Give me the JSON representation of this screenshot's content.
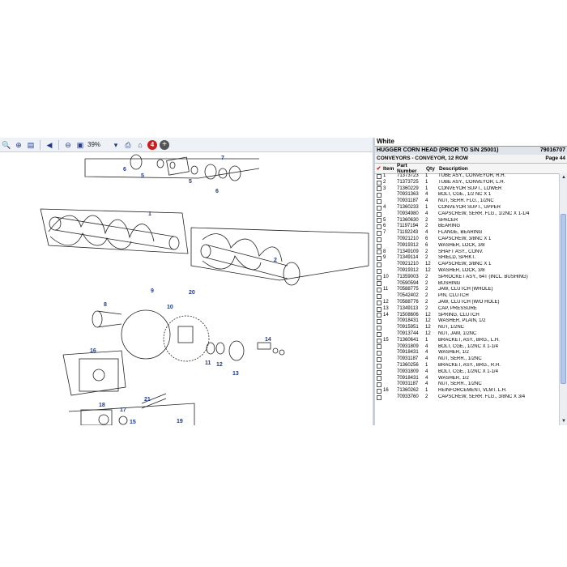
{
  "viewer": {
    "zoom": "39%",
    "badge_count": "4",
    "toolbar_icons": [
      "search-icon",
      "zoom-in-icon",
      "page-icon",
      "first-page-icon",
      "zoom-out-icon",
      "print-icon",
      "home-icon",
      "sync-icon",
      "help-icon",
      "add-icon"
    ]
  },
  "diagram": {
    "labels": [
      "7",
      "6",
      "5",
      "5",
      "6",
      "1",
      "2",
      "9",
      "20",
      "10",
      "8",
      "11",
      "12",
      "16",
      "14",
      "13",
      "21",
      "18",
      "17",
      "19",
      "15"
    ]
  },
  "parts": {
    "make": "White",
    "model": "HUGGER CORN HEAD (PRIOR TO S/N 25001)",
    "model_number": "79016707",
    "section": "CONVEYORS - CONVEYOR, 12 ROW",
    "page": "Page 44",
    "columns": {
      "item": "Item",
      "part": "Part Number",
      "qty": "Qty",
      "desc": "Description"
    },
    "rows": [
      {
        "item": "1",
        "part": "71373723",
        "qty": "1",
        "desc": "TUBE ASY., CONVEYOR, R.H."
      },
      {
        "item": "2",
        "part": "71373725",
        "qty": "1",
        "desc": "TUBE ASY., CONVEYOR, L.H."
      },
      {
        "item": "3",
        "part": "71360229",
        "qty": "1",
        "desc": "CONVEYOR SUPT., LOWER"
      },
      {
        "item": "",
        "part": "70931363",
        "qty": "4",
        "desc": "BOLT, CGE., 1/2 NC X 1"
      },
      {
        "item": "",
        "part": "70931187",
        "qty": "4",
        "desc": "NUT, SERR. FLG., 1/2NC"
      },
      {
        "item": "4",
        "part": "71360233",
        "qty": "1",
        "desc": "CONVEYOR SUPT., UPPER"
      },
      {
        "item": "",
        "part": "70934980",
        "qty": "4",
        "desc": "CAPSCREW, SERR. FLG., 1/2NC X 1-1/4"
      },
      {
        "item": "5",
        "part": "71360630",
        "qty": "2",
        "desc": "SPACER"
      },
      {
        "item": "6",
        "part": "71197194",
        "qty": "2",
        "desc": "BEARING"
      },
      {
        "item": "7",
        "part": "71192243",
        "qty": "4",
        "desc": "FLANGE, BEARING"
      },
      {
        "item": "",
        "part": "70921210",
        "qty": "6",
        "desc": "CAPSCREW, 3/8NC X 1"
      },
      {
        "item": "",
        "part": "70919312",
        "qty": "6",
        "desc": "WASHER, LOCK, 3/8"
      },
      {
        "item": "8",
        "part": "71349109",
        "qty": "2",
        "desc": "SHAFT ASY., CONV."
      },
      {
        "item": "9",
        "part": "71349114",
        "qty": "2",
        "desc": "SHIELD, SPRKT."
      },
      {
        "item": "",
        "part": "70921210",
        "qty": "12",
        "desc": "CAPSCREW, 3/8NC X 1"
      },
      {
        "item": "",
        "part": "70919312",
        "qty": "12",
        "desc": "WASHER, LOCK, 3/8"
      },
      {
        "item": "10",
        "part": "71359003",
        "qty": "2",
        "desc": "SPROCKET ASY., 64T (INCL. BUSHING)"
      },
      {
        "item": "",
        "part": "70590594",
        "qty": "2",
        "desc": "BUSHING"
      },
      {
        "item": "11",
        "part": "70588775",
        "qty": "2",
        "desc": "JAW, CLUTCH (WHOLE)"
      },
      {
        "item": "",
        "part": "70542402",
        "qty": "2",
        "desc": "PIN, CLUTCH"
      },
      {
        "item": "12",
        "part": "70588776",
        "qty": "2",
        "desc": "JAW, CLUTCH (W/O HOLE)"
      },
      {
        "item": "13",
        "part": "71349113",
        "qty": "2",
        "desc": "CAP, PRESSURE"
      },
      {
        "item": "14",
        "part": "71508606",
        "qty": "12",
        "desc": "SPRING, CLUTCH"
      },
      {
        "item": "",
        "part": "70918431",
        "qty": "12",
        "desc": "WASHER, PLAIN, 1/2"
      },
      {
        "item": "",
        "part": "70915951",
        "qty": "12",
        "desc": "NUT, 1/2NC"
      },
      {
        "item": "",
        "part": "70913744",
        "qty": "12",
        "desc": "NUT, JAM, 1/2NC"
      },
      {
        "item": "15",
        "part": "71360641",
        "qty": "1",
        "desc": "BRACKET, ASY., BRG., L.H."
      },
      {
        "item": "",
        "part": "70931809",
        "qty": "4",
        "desc": "BOLT, CGE., 1/2NC X 1-1/4"
      },
      {
        "item": "",
        "part": "70918431",
        "qty": "4",
        "desc": "WASHER, 1/2"
      },
      {
        "item": "",
        "part": "70931187",
        "qty": "4",
        "desc": "NUT, SERR., 1/2NC"
      },
      {
        "item": "",
        "part": "71360256",
        "qty": "1",
        "desc": "BRACKET, ASY., BRG., R.H."
      },
      {
        "item": "",
        "part": "70931809",
        "qty": "4",
        "desc": "BOLT, CGE., 1/2NC X 1-1/4"
      },
      {
        "item": "",
        "part": "70918431",
        "qty": "4",
        "desc": "WASHER, 1/2"
      },
      {
        "item": "",
        "part": "70931187",
        "qty": "4",
        "desc": "NUT, SERR., 1/2NC"
      },
      {
        "item": "16",
        "part": "71360262",
        "qty": "1",
        "desc": "REINFORCEMENT, VLMT. L.H."
      },
      {
        "item": "",
        "part": "70933760",
        "qty": "2",
        "desc": "CAPSCREW, SERR. FLG., 3/8NC X 3/4"
      }
    ]
  },
  "colors": {
    "accent": "#1e3a8a",
    "badge": "#c81e1e",
    "thumb": "#b6c8e6"
  }
}
